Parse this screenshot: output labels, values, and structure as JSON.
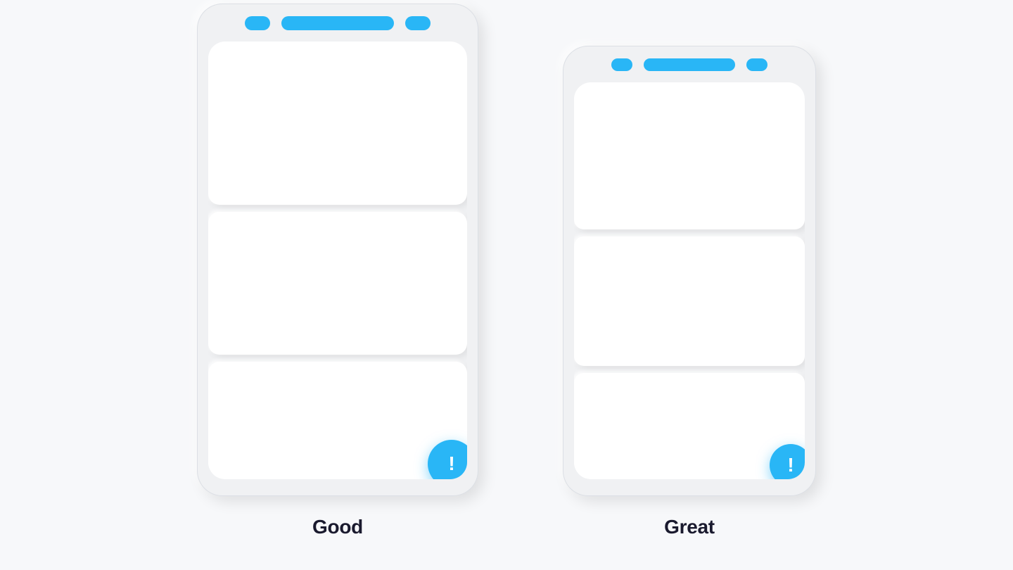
{
  "page": {
    "background": "#f7f8fa",
    "accent_color": "#29b6f6"
  },
  "phones": [
    {
      "id": "good",
      "label": "Good",
      "size": "large",
      "header": {
        "left_dot": true,
        "bar": true,
        "right_dot": true
      },
      "cards": [
        {
          "id": "card1",
          "flex": 2.5
        },
        {
          "id": "card2",
          "flex": 2.2
        },
        {
          "id": "card3",
          "flex": 1.8
        }
      ],
      "fab": {
        "icon": "!",
        "label": "fab-button"
      }
    },
    {
      "id": "great",
      "label": "Great",
      "size": "small",
      "header": {
        "left_dot": true,
        "bar": true,
        "right_dot": true
      },
      "cards": [
        {
          "id": "card1",
          "flex": 2.5
        },
        {
          "id": "card2",
          "flex": 2.2
        },
        {
          "id": "card3",
          "flex": 1.8
        }
      ],
      "fab": {
        "icon": "!",
        "label": "fab-button"
      }
    }
  ],
  "labels": {
    "good": "Good",
    "great": "Great"
  }
}
